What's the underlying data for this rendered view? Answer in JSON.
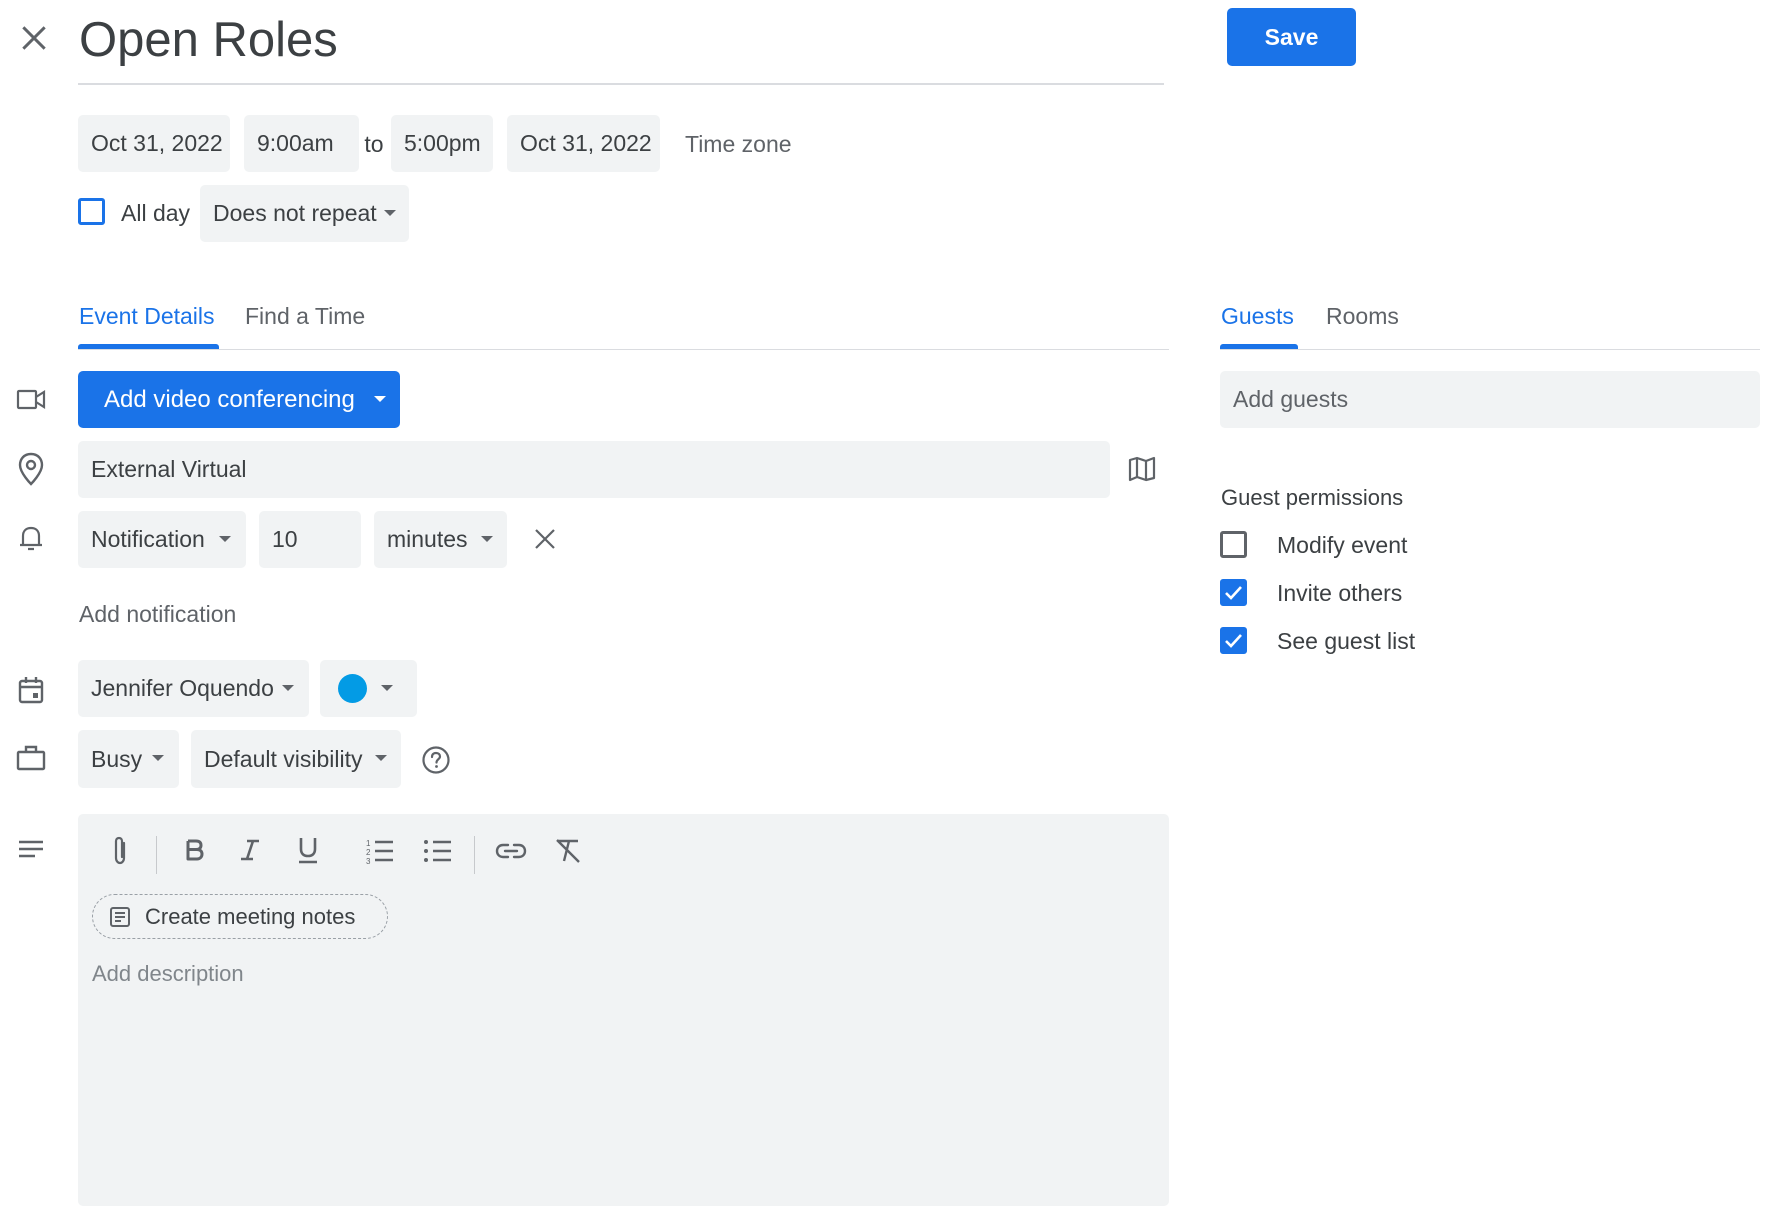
{
  "header": {
    "title": "Open Roles",
    "save_label": "Save"
  },
  "datetime": {
    "start_date": "Oct 31, 2022",
    "start_time": "9:00am",
    "to_label": "to",
    "end_time": "5:00pm",
    "end_date": "Oct 31, 2022",
    "timezone_label": "Time zone"
  },
  "allday": {
    "label": "All day",
    "checked": false,
    "repeat_value": "Does not repeat"
  },
  "left_tabs": [
    "Event Details",
    "Find a Time"
  ],
  "right_tabs": [
    "Guests",
    "Rooms"
  ],
  "details": {
    "video_label": "Add video conferencing",
    "location_value": "External Virtual",
    "notification_type": "Notification",
    "notification_amount": "10",
    "notification_unit": "minutes",
    "add_notification_label": "Add notification",
    "calendar_owner": "Jennifer Oquendo",
    "event_color": "#039be5",
    "availability": "Busy",
    "visibility": "Default visibility",
    "create_notes_label": "Create meeting notes",
    "description_placeholder": "Add description"
  },
  "guests": {
    "placeholder": "Add guests",
    "permissions_title": "Guest permissions",
    "permissions": [
      {
        "label": "Modify event",
        "checked": false
      },
      {
        "label": "Invite others",
        "checked": true
      },
      {
        "label": "See guest list",
        "checked": true
      }
    ]
  },
  "colors": {
    "accent": "#1a73e8",
    "field_bg": "#f1f3f4"
  }
}
